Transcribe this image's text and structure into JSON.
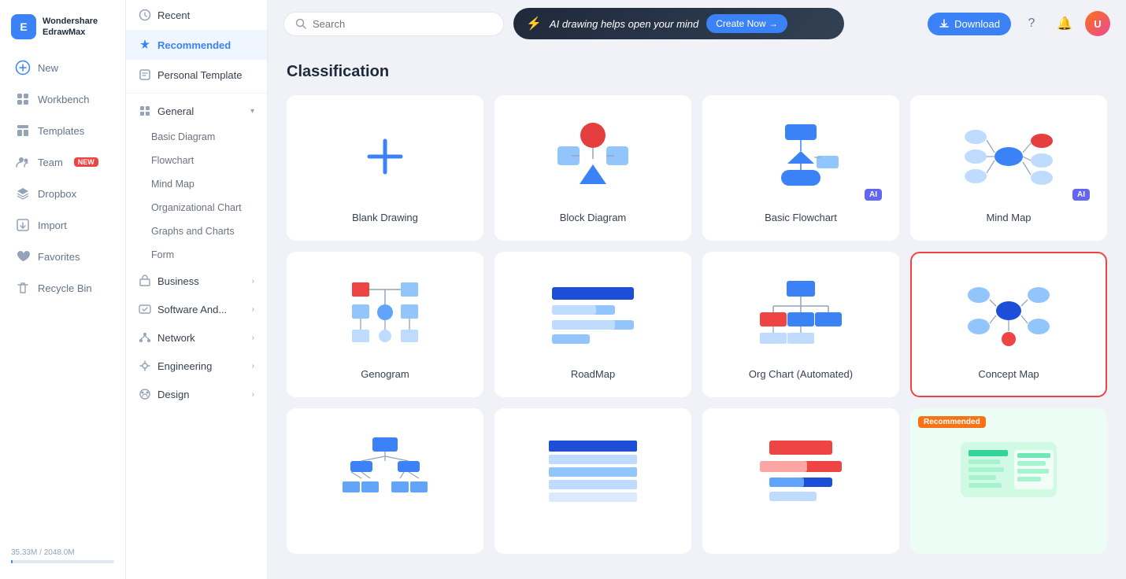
{
  "app": {
    "name": "Wondershare",
    "subtitle": "EdrawMax"
  },
  "sidebar": {
    "items": [
      {
        "id": "new",
        "label": "New",
        "icon": "plus"
      },
      {
        "id": "workbench",
        "label": "Workbench",
        "icon": "grid"
      },
      {
        "id": "templates",
        "label": "Templates",
        "icon": "template"
      },
      {
        "id": "team",
        "label": "Team",
        "icon": "users",
        "badge": "NEW"
      },
      {
        "id": "dropbox",
        "label": "Dropbox",
        "icon": "box"
      },
      {
        "id": "import",
        "label": "Import",
        "icon": "import"
      },
      {
        "id": "favorites",
        "label": "Favorites",
        "icon": "heart"
      },
      {
        "id": "recycle-bin",
        "label": "Recycle Bin",
        "icon": "trash"
      }
    ],
    "storage": {
      "used": "35.33M",
      "total": "2048.0M",
      "label": "35.33M / 2048.0M"
    }
  },
  "second_panel": {
    "items": [
      {
        "id": "recent",
        "label": "Recent",
        "type": "item"
      },
      {
        "id": "recommended",
        "label": "Recommended",
        "type": "item",
        "active": true
      },
      {
        "id": "personal-template",
        "label": "Personal Template",
        "type": "item"
      }
    ],
    "groups": [
      {
        "id": "general",
        "label": "General",
        "expanded": true,
        "children": [
          "Basic Diagram",
          "Flowchart",
          "Mind Map",
          "Organizational Chart",
          "Graphs and Charts",
          "Form"
        ]
      },
      {
        "id": "business",
        "label": "Business",
        "expanded": false
      },
      {
        "id": "software-and",
        "label": "Software And...",
        "expanded": false
      },
      {
        "id": "network",
        "label": "Network",
        "expanded": false
      },
      {
        "id": "engineering",
        "label": "Engineering",
        "expanded": false
      },
      {
        "id": "design",
        "label": "Design",
        "expanded": false
      }
    ]
  },
  "topbar": {
    "search_placeholder": "Search",
    "ai_banner_text": "AI drawing helps open your mind",
    "create_now_label": "Create Now →",
    "download_label": "Download"
  },
  "content": {
    "title": "Classification",
    "cards": [
      {
        "id": "blank-drawing",
        "label": "Blank Drawing",
        "type": "blank",
        "ai": false,
        "selected": false,
        "recommended": false
      },
      {
        "id": "block-diagram",
        "label": "Block Diagram",
        "type": "block",
        "ai": false,
        "selected": false,
        "recommended": false
      },
      {
        "id": "basic-flowchart",
        "label": "Basic Flowchart",
        "type": "flowchart",
        "ai": true,
        "selected": false,
        "recommended": false
      },
      {
        "id": "mind-map",
        "label": "Mind Map",
        "type": "mindmap",
        "ai": true,
        "selected": false,
        "recommended": false
      },
      {
        "id": "genogram",
        "label": "Genogram",
        "type": "genogram",
        "ai": false,
        "selected": false,
        "recommended": false
      },
      {
        "id": "roadmap",
        "label": "RoadMap",
        "type": "roadmap",
        "ai": false,
        "selected": false,
        "recommended": false
      },
      {
        "id": "org-chart-auto",
        "label": "Org Chart (Automated)",
        "type": "orgchart",
        "ai": false,
        "selected": false,
        "recommended": false
      },
      {
        "id": "concept-map",
        "label": "Concept Map",
        "type": "conceptmap",
        "ai": false,
        "selected": true,
        "recommended": false
      },
      {
        "id": "card9",
        "label": "",
        "type": "tree",
        "ai": false,
        "selected": false,
        "recommended": false
      },
      {
        "id": "card10",
        "label": "",
        "type": "table",
        "ai": false,
        "selected": false,
        "recommended": false
      },
      {
        "id": "card11",
        "label": "",
        "type": "timeline",
        "ai": false,
        "selected": false,
        "recommended": false
      },
      {
        "id": "card12",
        "label": "",
        "type": "featured",
        "ai": false,
        "selected": false,
        "recommended": true
      }
    ]
  }
}
